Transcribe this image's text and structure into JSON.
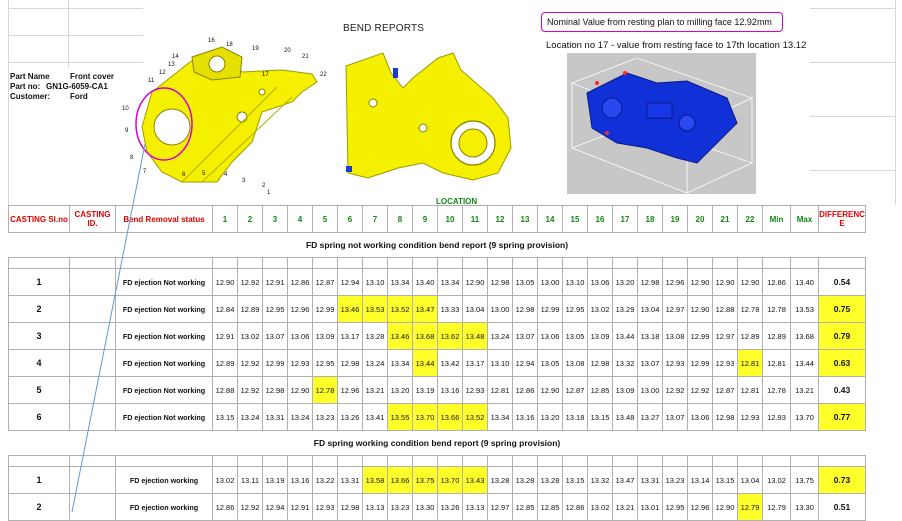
{
  "report_title": "BEND REPORTS",
  "part_info": [
    {
      "label": "Part Name",
      "value": "Front cover"
    },
    {
      "label": "Part no:",
      "value": "GN1G-6059-CA1"
    },
    {
      "label": "Customer:",
      "value": "Ford"
    }
  ],
  "nominal_note": "Nominal Value from resting plan to milling face 12.92mm",
  "location17_note": "Location no 17 -  value from resting face to 17th location 13.12",
  "location_caption": "LOCATION",
  "drawing_labels": [
    "16",
    "18",
    "19",
    "20",
    "21",
    "22",
    "14",
    "13",
    "12",
    "11",
    "10",
    "9",
    "8",
    "7",
    "6",
    "5",
    "4",
    "3",
    "2",
    "1",
    "17"
  ],
  "table": {
    "headers": {
      "casting_sl": "CASTING Sl.no",
      "casting_id": "CASTING ID.",
      "status": "Bend Removal status",
      "locations": [
        "1",
        "2",
        "3",
        "4",
        "5",
        "6",
        "7",
        "8",
        "9",
        "10",
        "11",
        "12",
        "13",
        "14",
        "15",
        "16",
        "17",
        "18",
        "19",
        "20",
        "21",
        "22"
      ],
      "min": "Min",
      "max": "Max",
      "difference": "DIFFERENC E"
    },
    "sections": [
      {
        "title": "FD spring not working condition bend report (9 spring provision)",
        "rows": [
          {
            "sl": "1",
            "status": "FD ejection Not working",
            "values": [
              "12.90",
              "12.92",
              "12.91",
              "12.86",
              "12.87",
              "12.94",
              "13.10",
              "13.34",
              "13.40",
              "13.34",
              "12.90",
              "12.98",
              "13.05",
              "13.00",
              "13.10",
              "13.06",
              "13.20",
              "12.98",
              "12.96",
              "12.90",
              "12.90",
              "12.90"
            ],
            "min": "12.86",
            "max": "13.40",
            "diff": "0.54",
            "yellow": [],
            "diff_yellow": false
          },
          {
            "sl": "2",
            "status": "FD ejection Not working",
            "values": [
              "12.84",
              "12.89",
              "12.95",
              "12.96",
              "12.99",
              "13.46",
              "13.53",
              "13.52",
              "13.47",
              "13.33",
              "13.04",
              "13.00",
              "12.98",
              "12.99",
              "12.95",
              "13.02",
              "13.29",
              "13.04",
              "12.97",
              "12.90",
              "12.88",
              "12.78"
            ],
            "min": "12.78",
            "max": "13.53",
            "diff": "0.75",
            "yellow": [
              5,
              6,
              7,
              8
            ],
            "diff_yellow": true
          },
          {
            "sl": "3",
            "status": "FD ejection Not working",
            "values": [
              "12.91",
              "13.02",
              "13.07",
              "13.06",
              "13.09",
              "13.17",
              "13.28",
              "13.46",
              "13.68",
              "13.62",
              "13.48",
              "13.24",
              "13.07",
              "13.06",
              "13.05",
              "13.09",
              "13.44",
              "13.18",
              "13.08",
              "12.99",
              "12.97",
              "12.89"
            ],
            "min": "12.89",
            "max": "13.68",
            "diff": "0.79",
            "yellow": [
              7,
              8,
              9,
              10
            ],
            "diff_yellow": true
          },
          {
            "sl": "4",
            "status": "FD ejection Not working",
            "values": [
              "12.89",
              "12.92",
              "12.99",
              "12.93",
              "12.95",
              "12.98",
              "13.24",
              "13.34",
              "13.44",
              "13.42",
              "13.17",
              "13.10",
              "12.94",
              "13.05",
              "13.08",
              "12.98",
              "13.32",
              "13.07",
              "12.93",
              "12.99",
              "12.93",
              "12.81"
            ],
            "min": "12.81",
            "max": "13.44",
            "diff": "0.63",
            "yellow": [
              8,
              21
            ],
            "diff_yellow": true
          },
          {
            "sl": "5",
            "status": "FD ejection Not working",
            "values": [
              "12.88",
              "12.92",
              "12.98",
              "12.90",
              "12.78",
              "12.96",
              "13.21",
              "13.20",
              "13.19",
              "13.16",
              "12.93",
              "12.81",
              "12.86",
              "12.90",
              "12.87",
              "12.85",
              "13.09",
              "13.00",
              "12.92",
              "12.92",
              "12.87",
              "12.81"
            ],
            "min": "12.78",
            "max": "13.21",
            "diff": "0.43",
            "yellow": [
              4
            ],
            "diff_yellow": false
          },
          {
            "sl": "6",
            "status": "FD ejection Not working",
            "values": [
              "13.15",
              "13.24",
              "13.31",
              "13.24",
              "13.23",
              "13.26",
              "13.41",
              "13.55",
              "13.70",
              "13.66",
              "13.52",
              "13.34",
              "13.16",
              "13.20",
              "13.18",
              "13.15",
              "13.48",
              "13.27",
              "13.07",
              "13.06",
              "12.98",
              "12.93"
            ],
            "min": "12.93",
            "max": "13.70",
            "diff": "0.77",
            "yellow": [
              7,
              8,
              9,
              10
            ],
            "diff_yellow": true
          }
        ]
      },
      {
        "title": "FD spring working condition bend report (9 spring provision)",
        "rows": [
          {
            "sl": "1",
            "status": "FD ejection working",
            "values": [
              "13.02",
              "13.11",
              "13.19",
              "13.16",
              "13.22",
              "13.31",
              "13.58",
              "13.66",
              "13.75",
              "13.70",
              "13.43",
              "13.28",
              "13.28",
              "13.28",
              "13.15",
              "13.32",
              "13.47",
              "13.31",
              "13.23",
              "13.14",
              "13.15",
              "13.04"
            ],
            "min": "13.02",
            "max": "13.75",
            "diff": "0.73",
            "yellow": [
              6,
              7,
              8,
              9,
              10
            ],
            "diff_yellow": true
          },
          {
            "sl": "2",
            "status": "FD ejection working",
            "values": [
              "12.86",
              "12.92",
              "12.94",
              "12.91",
              "12.93",
              "12.98",
              "13.13",
              "13.23",
              "13.30",
              "13.26",
              "13.13",
              "12.97",
              "12.85",
              "12.85",
              "12.86",
              "13.02",
              "13.21",
              "13.01",
              "12.95",
              "12.96",
              "12.90",
              "12.79"
            ],
            "min": "12.79",
            "max": "13.30",
            "diff": "0.51",
            "yellow": [
              21
            ],
            "diff_yellow": false
          }
        ]
      }
    ]
  }
}
